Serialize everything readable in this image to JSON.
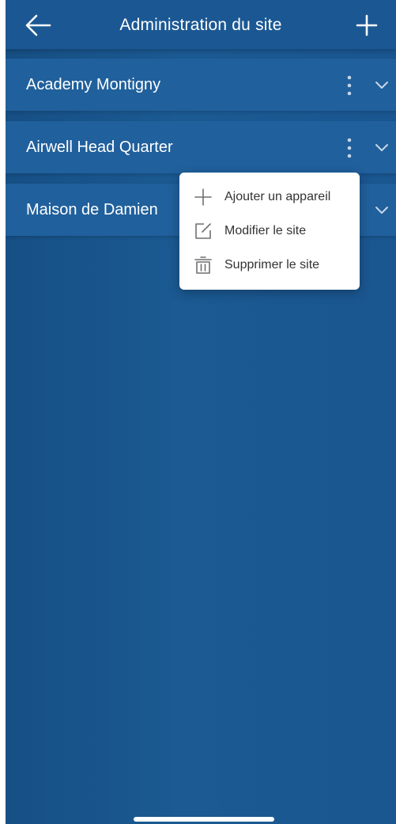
{
  "header": {
    "title": "Administration du site",
    "back_icon": "arrow-left-icon",
    "add_icon": "plus-icon"
  },
  "sites": [
    {
      "label": "Academy Montigny"
    },
    {
      "label": "Airwell Head Quarter"
    },
    {
      "label": "Maison de Damien"
    }
  ],
  "context_menu": {
    "items": [
      {
        "label": "Ajouter un appareil",
        "icon": "plus-icon"
      },
      {
        "label": "Modifier le site",
        "icon": "edit-icon"
      },
      {
        "label": "Supprimer le site",
        "icon": "trash-icon"
      }
    ]
  },
  "colors": {
    "background": "#1a5690",
    "row": "#20609c",
    "header": "#1b5893",
    "text": "#ffffff",
    "menu_text": "#333333",
    "menu_icon": "#6f6f6f"
  }
}
